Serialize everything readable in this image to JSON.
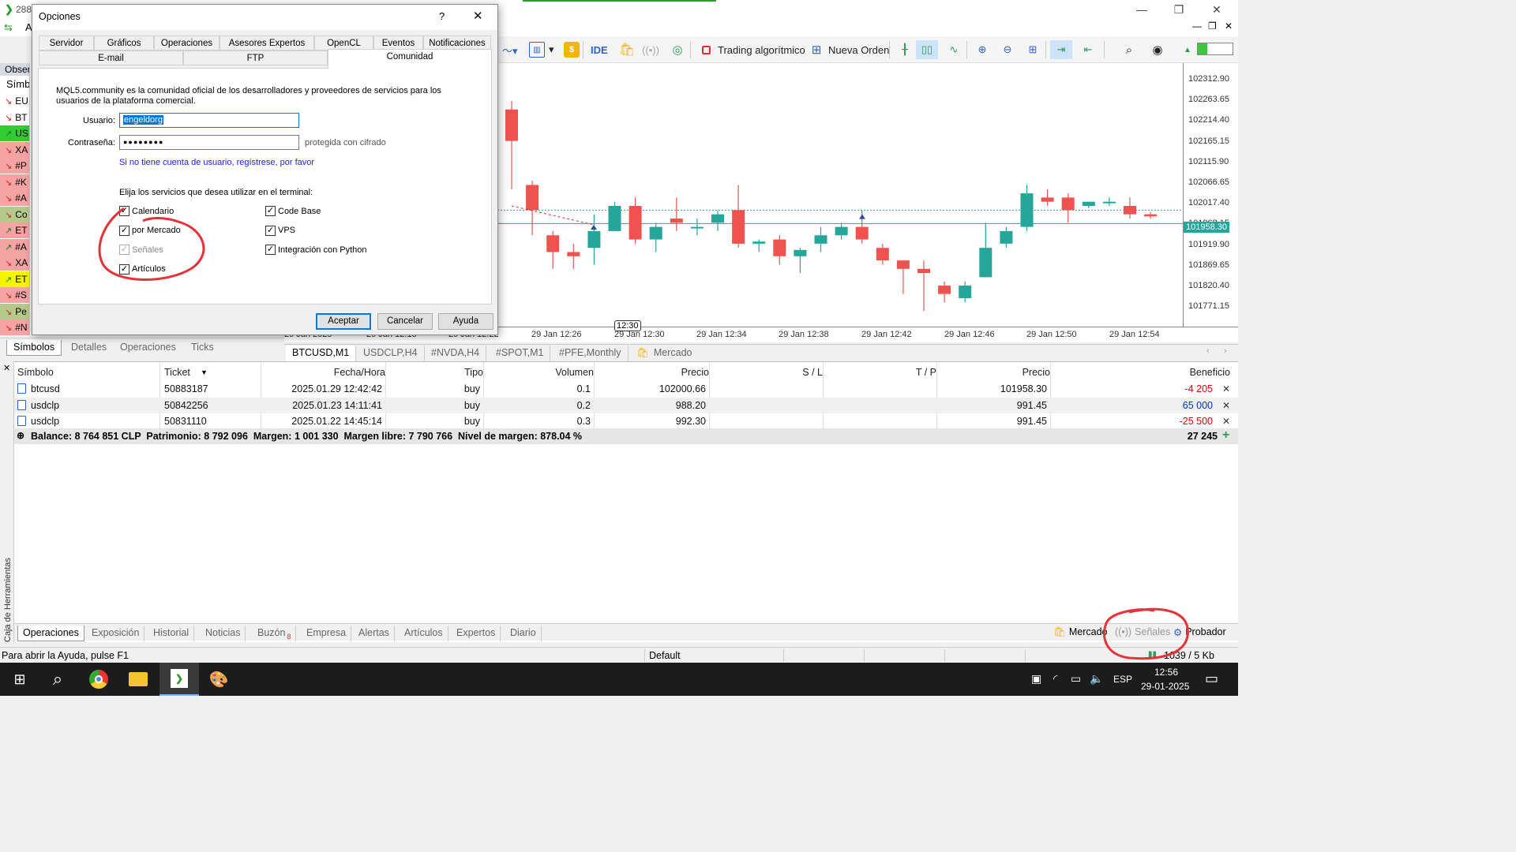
{
  "window": {
    "title_prefix": "288",
    "menu_prefix": "A"
  },
  "toolbar": {
    "ide": "IDE",
    "algo_trading": "Trading algorítmico",
    "new_order": "Nueva Orden"
  },
  "market_watch": {
    "header": "Obser",
    "col": "Símbo",
    "rows": [
      {
        "sym": "EU",
        "dir": "down",
        "bg": "#ffffff"
      },
      {
        "sym": "BT",
        "dir": "down",
        "bg": "#ffffff"
      },
      {
        "sym": "US",
        "dir": "up",
        "bg": "#33cc33"
      },
      {
        "sym": "XA",
        "dir": "down",
        "bg": "#f5a3a3"
      },
      {
        "sym": "#P",
        "dir": "down",
        "bg": "#f5a3a3"
      },
      {
        "sym": "#K",
        "dir": "down",
        "bg": "#f5a3a3"
      },
      {
        "sym": "#A",
        "dir": "down",
        "bg": "#f5a3a3"
      },
      {
        "sym": "Co",
        "dir": "down",
        "bg": "#b5c98a"
      },
      {
        "sym": "ET",
        "dir": "up",
        "bg": "#f5a3a3"
      },
      {
        "sym": "#A",
        "dir": "up",
        "bg": "#f5a3a3"
      },
      {
        "sym": "XA",
        "dir": "down",
        "bg": "#f5a3a3"
      },
      {
        "sym": "ET",
        "dir": "up",
        "bg": "#f5f500"
      },
      {
        "sym": "#S",
        "dir": "down",
        "bg": "#f5a3a3"
      },
      {
        "sym": "Pe",
        "dir": "down",
        "bg": "#b5c98a"
      },
      {
        "sym": "#N",
        "dir": "down",
        "bg": "#f5a3a3"
      }
    ]
  },
  "chart": {
    "current_price": "101958.30",
    "price_labels": [
      "102312.90",
      "102263.65",
      "102214.40",
      "102165.15",
      "102115.90",
      "102066.65",
      "102017.40",
      "101968.15",
      "101919.90",
      "101869.65",
      "101820.40",
      "101771.15"
    ],
    "time_labels": [
      "29 Jan 2025",
      "29 Jan 12:18",
      "29 Jan 12:22",
      "29 Jan 12:26",
      "29 Jan 12:30",
      "29 Jan 12:34",
      "29 Jan 12:38",
      "29 Jan 12:42",
      "29 Jan 12:46",
      "29 Jan 12:50",
      "29 Jan 12:54"
    ],
    "time_marker": "12:30",
    "up_color": "#26a69a",
    "down_color": "#ef5350"
  },
  "left_tabs": [
    "Símbolos",
    "Detalles",
    "Operaciones",
    "Ticks"
  ],
  "chart_tabs": [
    "BTCUSD,M1",
    "USDCLP,H4",
    "#NVDA,H4",
    "#SPOT,M1",
    "#PFE,Monthly",
    "Mercado"
  ],
  "trades": {
    "headers": [
      "Símbolo",
      "Ticket",
      "Fecha/Hora",
      "Tipo",
      "Volumen",
      "Precio",
      "S / L",
      "T / P",
      "Precio",
      "Beneficio"
    ],
    "rows": [
      {
        "symbol": "btcusd",
        "ticket": "50883187",
        "time": "2025.01.29 12:42:42",
        "type": "buy",
        "volume": "0.1",
        "price": "102000.66",
        "sl": "",
        "tp": "",
        "cur": "101958.30",
        "profit": "-4 205",
        "profit_color": "#e00000"
      },
      {
        "symbol": "usdclp",
        "ticket": "50842256",
        "time": "2025.01.23 14:11:41",
        "type": "buy",
        "volume": "0.2",
        "price": "988.20",
        "sl": "",
        "tp": "",
        "cur": "991.45",
        "profit": "65 000",
        "profit_color": "#0033cc"
      },
      {
        "symbol": "usdclp",
        "ticket": "50831110",
        "time": "2025.01.22 14:45:14",
        "type": "buy",
        "volume": "0.3",
        "price": "992.30",
        "sl": "",
        "tp": "",
        "cur": "991.45",
        "profit": "-25 500",
        "profit_color": "#e00000"
      }
    ],
    "balance_line": "Balance: 8 764 851 CLP  Patrimonio: 8 792 096  Margen: 1 001 330  Margen libre: 7 790 766  Nivel de margen: 878.04 %",
    "total": "27 245"
  },
  "toolbox_label": "Caja de Herramientas",
  "bottom_tabs": [
    "Operaciones",
    "Exposición",
    "Historial",
    "Noticias",
    "Buzón",
    "Empresa",
    "Alertas",
    "Artículos",
    "Expertos",
    "Diario"
  ],
  "mailbox_count": "8",
  "bottom_right": {
    "market": "Mercado",
    "signals": "Señales",
    "tester": "Probador"
  },
  "status": {
    "help": "Para abrir la Ayuda, pulse F1",
    "profile": "Default",
    "traffic": "1039 / 5 Kb"
  },
  "taskbar": {
    "lang": "ESP",
    "time": "12:56",
    "date": "29-01-2025"
  },
  "dialog": {
    "title": "Opciones",
    "help": "?",
    "tabs_row1": [
      "Servidor",
      "Gráficos",
      "Operaciones",
      "Asesores Expertos",
      "OpenCL",
      "Eventos",
      "Notificaciones"
    ],
    "tabs_row2": [
      "E-mail",
      "FTP",
      "Comunidad"
    ],
    "description": "MQL5.community es la comunidad oficial de los desarrolladores y proveedores de servicios para los usuarios de la plataforma comercial.",
    "user_label": "Usuario:",
    "user_value": "engeldorg",
    "password_label": "Contraseña:",
    "password_value": "●●●●●●●●",
    "encrypted_note": "protegida con cifrado",
    "register_link": "Si no tiene cuenta de usuario, regístrese, por favor",
    "services_label": "Elija los servicios que desea utilizar en el terminal:",
    "services_left": [
      {
        "label": "Calendario",
        "checked": true,
        "disabled": false
      },
      {
        "label": "por Mercado",
        "checked": true,
        "disabled": false
      },
      {
        "label": "Señales",
        "checked": true,
        "disabled": true
      },
      {
        "label": "Artículos",
        "checked": true,
        "disabled": false
      }
    ],
    "services_right": [
      {
        "label": "Code Base",
        "checked": true
      },
      {
        "label": "VPS",
        "checked": true
      },
      {
        "label": "Integración con Python",
        "checked": true
      }
    ],
    "ok": "Aceptar",
    "cancel": "Cancelar",
    "help_btn": "Ayuda"
  }
}
